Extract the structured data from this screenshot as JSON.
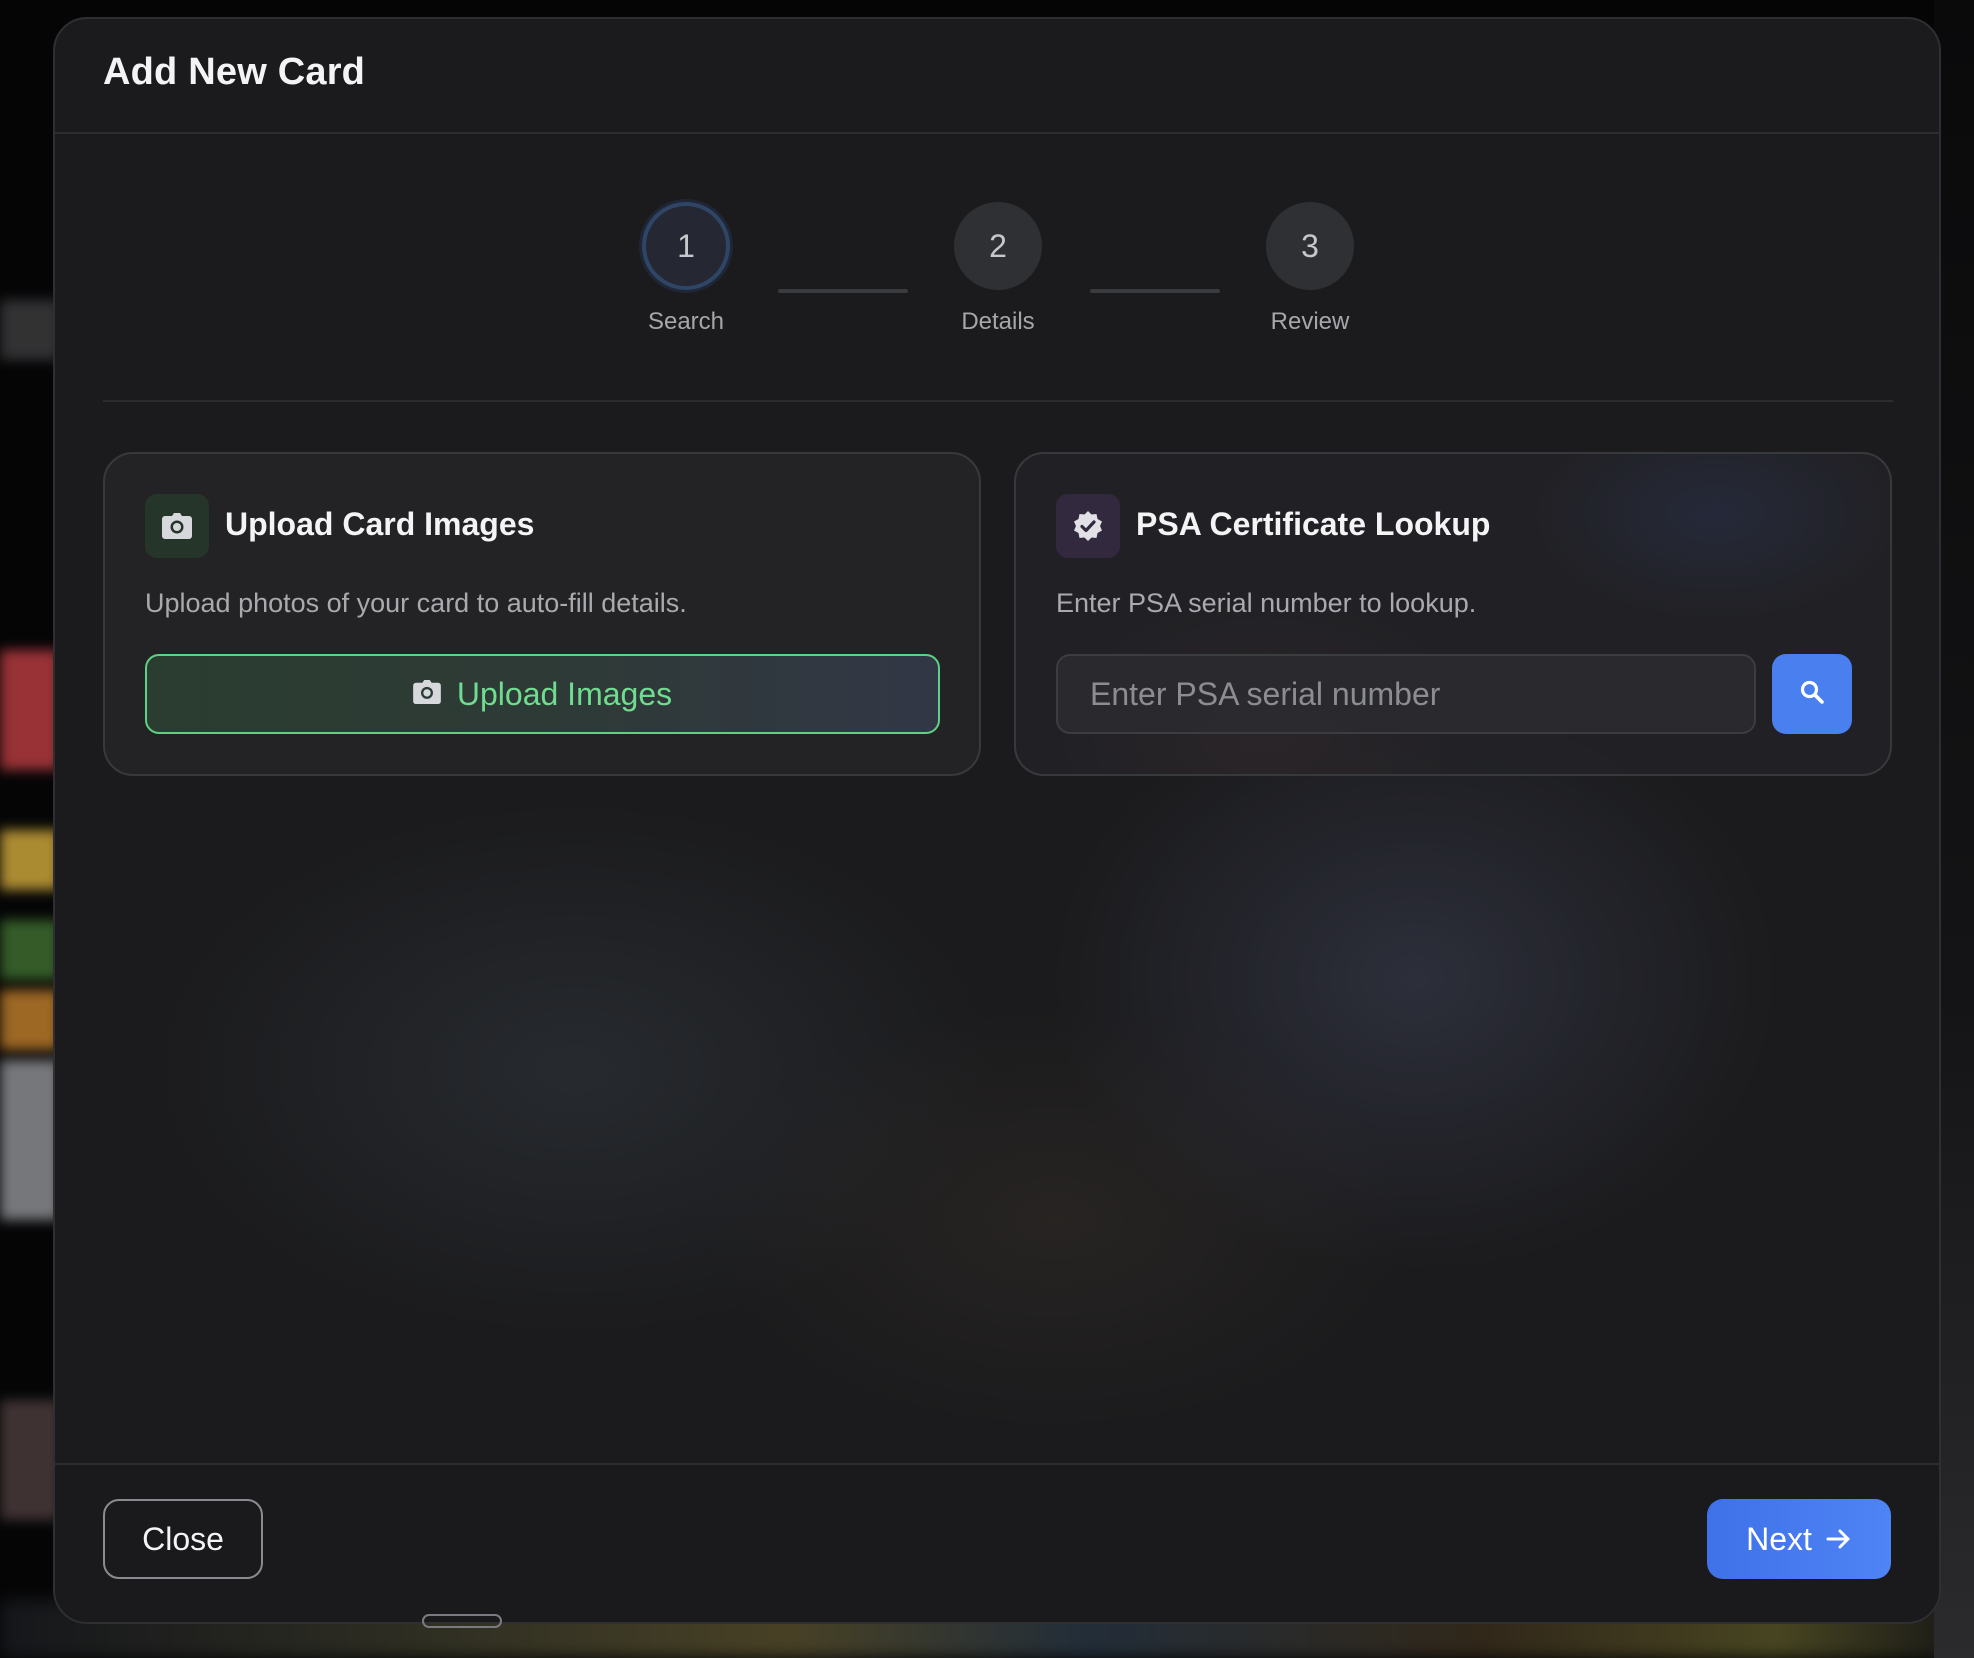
{
  "dialog": {
    "title": "Add New Card"
  },
  "stepper": {
    "steps": [
      {
        "number": "1",
        "label": "Search",
        "active": true
      },
      {
        "number": "2",
        "label": "Details",
        "active": false
      },
      {
        "number": "3",
        "label": "Review",
        "active": false
      }
    ]
  },
  "upload_panel": {
    "icon": "camera-icon",
    "title": "Upload Card Images",
    "description": "Upload photos of your card to auto-fill details.",
    "button_label": "Upload Images",
    "accent_color": "#6fdc8f"
  },
  "psa_panel": {
    "icon": "verified-badge-icon",
    "title": "PSA Certificate Lookup",
    "description": "Enter PSA serial number to lookup.",
    "input_value": "",
    "input_placeholder": "Enter PSA serial number",
    "search_icon": "search-icon",
    "accent_color": "#4a7ff0"
  },
  "footer": {
    "close_label": "Close",
    "next_label": "Next",
    "next_icon": "arrow-right-icon"
  }
}
